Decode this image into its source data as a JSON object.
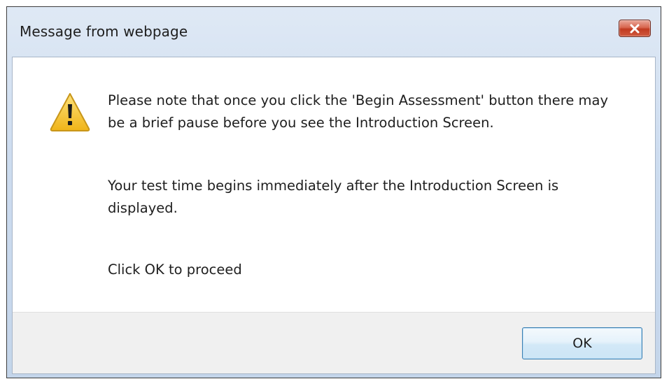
{
  "window": {
    "title": "Message from webpage",
    "close_icon": "close-icon"
  },
  "message": {
    "icon": "warning-icon",
    "paragraphs": [
      "Please note that once you click the 'Begin Assessment' button there may be a brief pause before you see the Introduction Screen.",
      "Your test time begins immediately after the Introduction Screen is displayed.",
      "Click OK to proceed"
    ]
  },
  "buttons": {
    "ok_label": "OK"
  },
  "colors": {
    "close_button": "#c13b21",
    "ok_button_border": "#3c7fb1",
    "warning_fill": "#f5c518"
  }
}
